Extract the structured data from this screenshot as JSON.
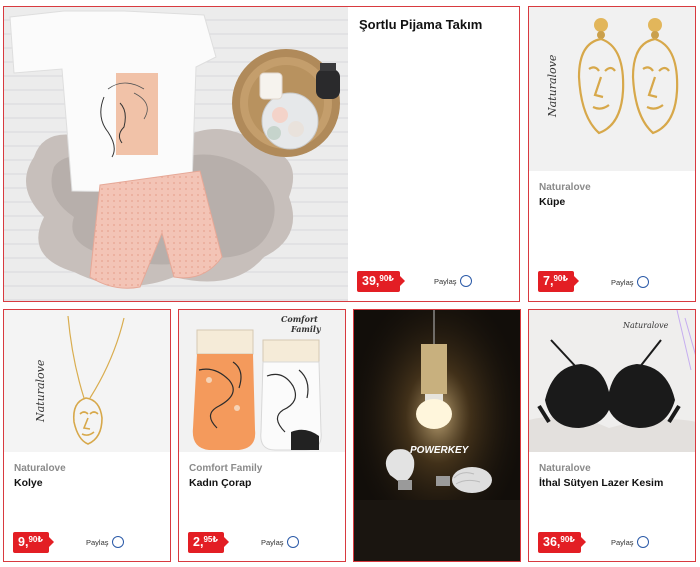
{
  "products": [
    {
      "brand": "",
      "title": "Şortlu Pijama Takım",
      "price_main": "39,",
      "price_sup": "90₺",
      "share_label": "Paylaş"
    },
    {
      "brand": "Naturalove",
      "title": "Küpe",
      "price_main": "7,",
      "price_sup": "90₺",
      "share_label": "Paylaş"
    },
    {
      "brand": "Naturalove",
      "title": "Kolye",
      "price_main": "9,",
      "price_sup": "90₺",
      "share_label": "Paylaş"
    },
    {
      "brand": "Comfort Family",
      "title": "Kadın Çorap",
      "price_main": "2,",
      "price_sup": "95₺",
      "share_label": "Paylaş"
    },
    {
      "brand": "Naturalove",
      "title": "İthal Sütyen Lazer Kesim",
      "price_main": "36,",
      "price_sup": "90₺",
      "share_label": "Paylaş"
    }
  ],
  "logos": {
    "naturalove": "Naturalove",
    "comfort_family_line1": "Comfort",
    "comfort_family_line2": "Family",
    "powerkey": "POWERKEY"
  },
  "colors": {
    "card_border": "#d83a3f",
    "price_bg": "#e31e24",
    "share_circle": "#2b5aa8"
  }
}
